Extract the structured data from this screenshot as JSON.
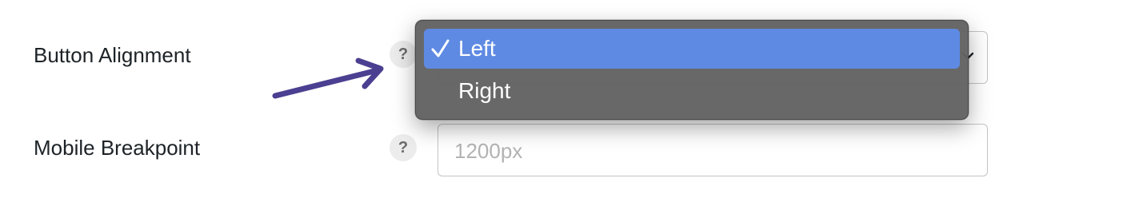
{
  "settings": {
    "button_alignment": {
      "label": "Button Alignment",
      "help_glyph": "?",
      "options": [
        {
          "label": "Left",
          "selected": true
        },
        {
          "label": "Right",
          "selected": false
        }
      ],
      "selected_check": "✓"
    },
    "mobile_breakpoint": {
      "label": "Mobile Breakpoint",
      "help_glyph": "?",
      "placeholder": "1200px"
    }
  },
  "colors": {
    "selected_option": "#5f8ae3",
    "menu_background": "#626262",
    "annotation_arrow": "#4b3f91"
  },
  "icons": [
    "question-mark-icon",
    "checkmark-icon",
    "chevron-down-icon",
    "annotation-arrow"
  ]
}
